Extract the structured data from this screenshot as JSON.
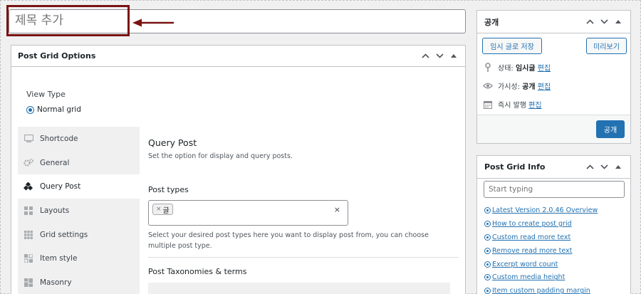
{
  "title": {
    "placeholder": "제목 추가"
  },
  "post_grid_options": {
    "heading": "Post Grid Options",
    "view_type": {
      "label": "View Type",
      "option": "Normal grid"
    },
    "tabs": [
      {
        "label": "Shortcode",
        "icon": "monitor-icon"
      },
      {
        "label": "General",
        "icon": "gears-icon"
      },
      {
        "label": "Query Post",
        "icon": "cubes-icon"
      },
      {
        "label": "Layouts",
        "icon": "layout-icon"
      },
      {
        "label": "Grid settings",
        "icon": "grid-icon"
      },
      {
        "label": "Item style",
        "icon": "item-style-icon"
      },
      {
        "label": "Masonry",
        "icon": "masonry-icon"
      }
    ],
    "active_tab": "Query Post",
    "query_post": {
      "title": "Query Post",
      "subtitle": "Set the option for display and query posts.",
      "post_types_label": "Post types",
      "selected_chip": "글",
      "chip_remove": "×",
      "clear": "×",
      "help": "Select your desired post types here you want to display post from, you can choose multiple post type.",
      "taxonomies_label": "Post Taxonomies & terms"
    }
  },
  "publish": {
    "heading": "공개",
    "save_draft": "임시 글로 저장",
    "preview": "미리보기",
    "status_label": "상태:",
    "status_value": "임시글",
    "visibility_label": "가시성:",
    "visibility_value": "공개",
    "schedule_label": "즉시 발행",
    "edit": "편집",
    "publish_button": "공개"
  },
  "post_grid_info": {
    "heading": "Post Grid Info",
    "search_placeholder": "Start typing",
    "links": [
      "Latest Version 2.0.46 Overview",
      "How to create post grid",
      "Custom read more text",
      "Remove read more text",
      "Excerpt word count",
      "Custom media height",
      "Item custom padding margin"
    ]
  },
  "colors": {
    "accent": "#2271b1",
    "highlight": "#7a1212"
  }
}
